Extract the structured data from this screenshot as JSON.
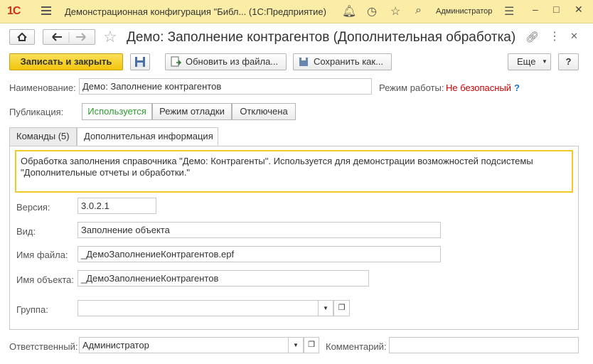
{
  "app": {
    "logo": "1С",
    "title": "Демонстрационная конфигурация \"Библ...  (1С:Предприятие)",
    "user": "Администратор"
  },
  "page": {
    "title": "Демо: Заполнение контрагентов (Дополнительная обработка)"
  },
  "toolbar": {
    "save_close": "Записать и закрыть",
    "update_from_file": "Обновить из файла...",
    "save_as": "Сохранить как...",
    "more": "Еще",
    "help": "?"
  },
  "form": {
    "name_label": "Наименование:",
    "name_value": "Демо: Заполнение контрагентов",
    "mode_label": "Режим работы:",
    "mode_value": "Не безопасный",
    "mode_help": "?",
    "publication_label": "Публикация:",
    "publication_options": [
      "Используется",
      "Режим отладки",
      "Отключена"
    ],
    "publication_selected": "Используется"
  },
  "tabs": [
    {
      "label": "Команды (5)",
      "active": false
    },
    {
      "label": "Дополнительная информация",
      "active": true
    }
  ],
  "info": {
    "description": "Обработка заполнения справочника \"Демо: Контрагенты\". Используется для демонстрации возможностей подсистемы \"Дополнительные отчеты и обработки.\"",
    "version_label": "Версия:",
    "version_value": "3.0.2.1",
    "kind_label": "Вид:",
    "kind_value": "Заполнение объекта",
    "file_label": "Имя файла:",
    "file_value": "_ДемоЗаполнениеКонтрагентов.epf",
    "object_label": "Имя объекта:",
    "object_value": "_ДемоЗаполнениеКонтрагентов",
    "group_label": "Группа:",
    "group_value": ""
  },
  "footer": {
    "responsible_label": "Ответственный:",
    "responsible_value": "Администратор",
    "comment_label": "Комментарий:",
    "comment_value": ""
  },
  "colors": {
    "accent": "#f2c50d",
    "title_bar": "#fbeda5",
    "warning": "#cc0000",
    "selected": "#2e9a2e",
    "help": "#1e73c8"
  }
}
